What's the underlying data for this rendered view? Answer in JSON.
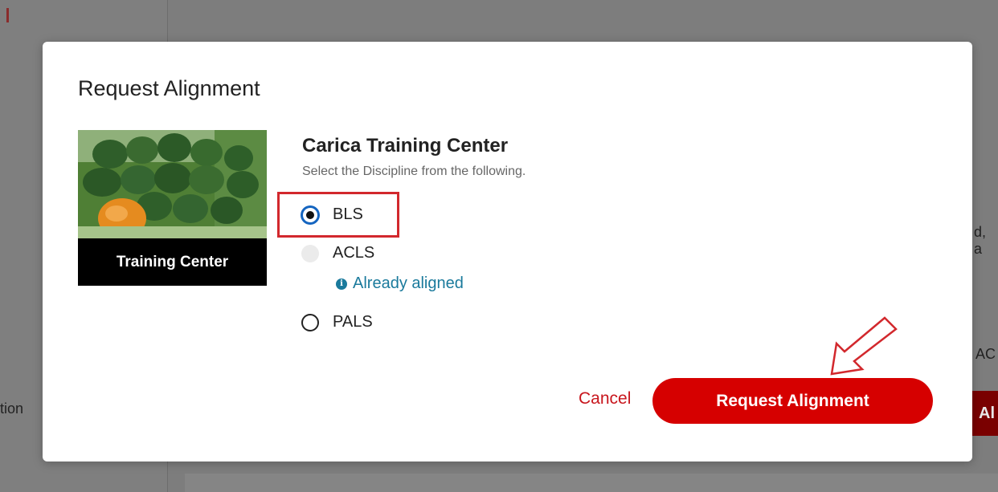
{
  "background": {
    "left_fragment": "tion",
    "right_fragment_1": "d, a",
    "right_fragment_2": "AC",
    "right_button_fragment": "Al"
  },
  "modal": {
    "title": "Request Alignment",
    "training_center": {
      "card_label": "Training Center",
      "name": "Carica Training Center",
      "instruction": "Select the Discipline from the following."
    },
    "disciplines": [
      {
        "label": "BLS",
        "selected": true,
        "disabled": false
      },
      {
        "label": "ACLS",
        "selected": false,
        "disabled": true,
        "note": "Already aligned"
      },
      {
        "label": "PALS",
        "selected": false,
        "disabled": false
      }
    ],
    "cancel_label": "Cancel",
    "submit_label": "Request Alignment"
  },
  "colors": {
    "accent": "#d60000",
    "info": "#1a7a9c",
    "highlight": "#d2282d"
  }
}
